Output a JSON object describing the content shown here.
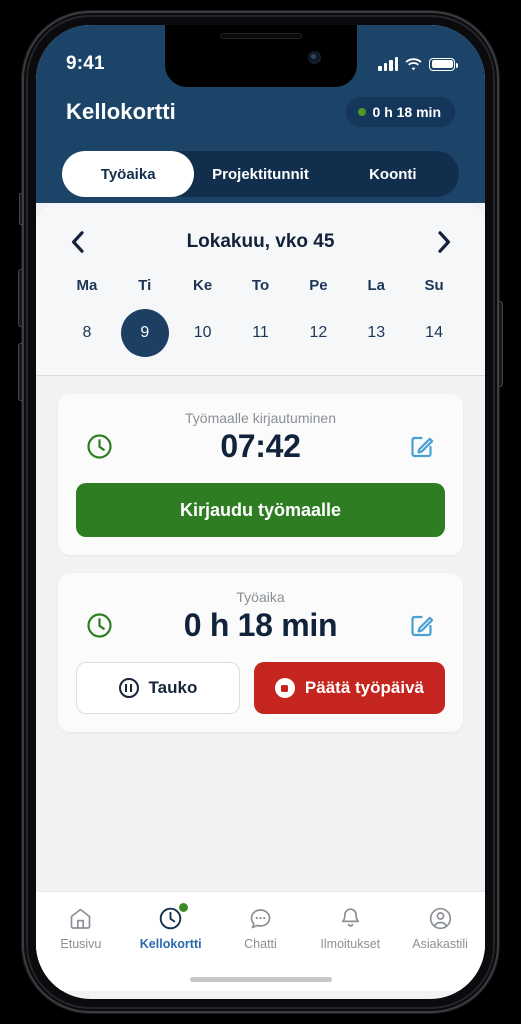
{
  "status_bar": {
    "time": "9:41",
    "signal_icon": "signal-bars-icon",
    "wifi_icon": "wifi-icon",
    "battery_icon": "battery-full-icon"
  },
  "header": {
    "title": "Kellokortti",
    "badge": {
      "text": "0 h 18 min",
      "dot_color": "#4b9b28"
    },
    "background_color": "#1c4468"
  },
  "tabs": [
    {
      "label": "Työaika",
      "active": true
    },
    {
      "label": "Projektitunnit",
      "active": false
    },
    {
      "label": "Koonti",
      "active": false
    }
  ],
  "calendar": {
    "prev_icon": "chevron-left-icon",
    "next_icon": "chevron-right-icon",
    "month_label": "Lokakuu, vko 45",
    "weekday_names": [
      "Ma",
      "Ti",
      "Ke",
      "To",
      "Pe",
      "La",
      "Su"
    ],
    "dates": [
      "8",
      "9",
      "10",
      "11",
      "12",
      "13",
      "14"
    ],
    "selected_date": "9",
    "selected_color": "#1c3f63"
  },
  "checkin_card": {
    "clock_icon": "clock-icon",
    "label": "Työmaalle kirjautuminen",
    "value": "07:42",
    "edit_icon": "edit-pencil-icon",
    "button_label": "Kirjaudu työmaalle",
    "button_color": "#2e7d23"
  },
  "worktime_card": {
    "clock_icon": "clock-icon",
    "label": "Työaika",
    "value": "0 h 18 min",
    "edit_icon": "edit-pencil-icon",
    "break_button": {
      "label": "Tauko",
      "icon": "pause-circle-icon"
    },
    "end_day_button": {
      "label": "Päätä työpäivä",
      "icon": "stop-circle-icon",
      "color": "#c4251f"
    }
  },
  "bottom_nav": [
    {
      "label": "Etusivu",
      "icon": "home-icon",
      "active": false,
      "badge": false
    },
    {
      "label": "Kellokortti",
      "icon": "clock-icon",
      "active": true,
      "badge": true
    },
    {
      "label": "Chatti",
      "icon": "chat-bubble-icon",
      "active": false,
      "badge": false
    },
    {
      "label": "Ilmoitukset",
      "icon": "bell-icon",
      "active": false,
      "badge": false
    },
    {
      "label": "Asiakastili",
      "icon": "user-circle-icon",
      "active": false,
      "badge": false
    }
  ]
}
